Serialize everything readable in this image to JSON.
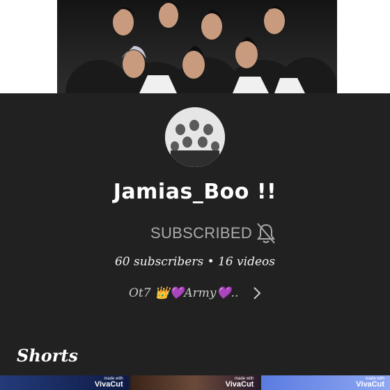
{
  "channel": {
    "name": "Jamias_Boo !!",
    "subscribe_state": "SUBSCRIBED",
    "stats": "60 subscribers • 16 videos",
    "description": "Ot7 👑💜Army💜.."
  },
  "shorts": {
    "title": "Shorts",
    "items": [
      {
        "watermark_small": "made with",
        "watermark_brand": "VivaCut"
      },
      {
        "watermark_small": "made with",
        "watermark_brand": "VivaCut"
      },
      {
        "watermark_small": "made with",
        "watermark_brand": "VivaCut"
      }
    ]
  },
  "icons": {
    "notification": "bell-off-icon",
    "more": "chevron-right-icon"
  },
  "colors": {
    "background": "#212121",
    "secondary_text": "#aaaaaa"
  }
}
